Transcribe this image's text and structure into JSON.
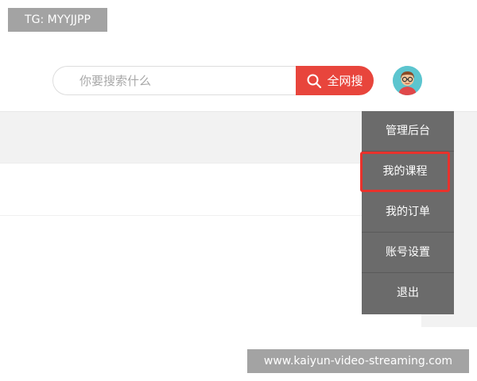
{
  "watermarks": {
    "top": "TG: MYYJJPP",
    "bottom": "www.kaiyun-video-streaming.com"
  },
  "search": {
    "placeholder": "你要搜索什么",
    "button_label": "全网搜",
    "icon": "search-icon"
  },
  "user": {
    "avatar_icon": "avatar-with-glasses"
  },
  "menu": {
    "items": [
      {
        "label": "管理后台"
      },
      {
        "label": "我的课程",
        "highlighted": true
      },
      {
        "label": "我的订单"
      },
      {
        "label": "账号设置"
      },
      {
        "label": "退出"
      }
    ]
  },
  "colors": {
    "accent": "#e8453c",
    "menu_bg": "#6b6b6b",
    "highlight_border": "#e8322c",
    "avatar_bg": "#5cc5cf"
  }
}
